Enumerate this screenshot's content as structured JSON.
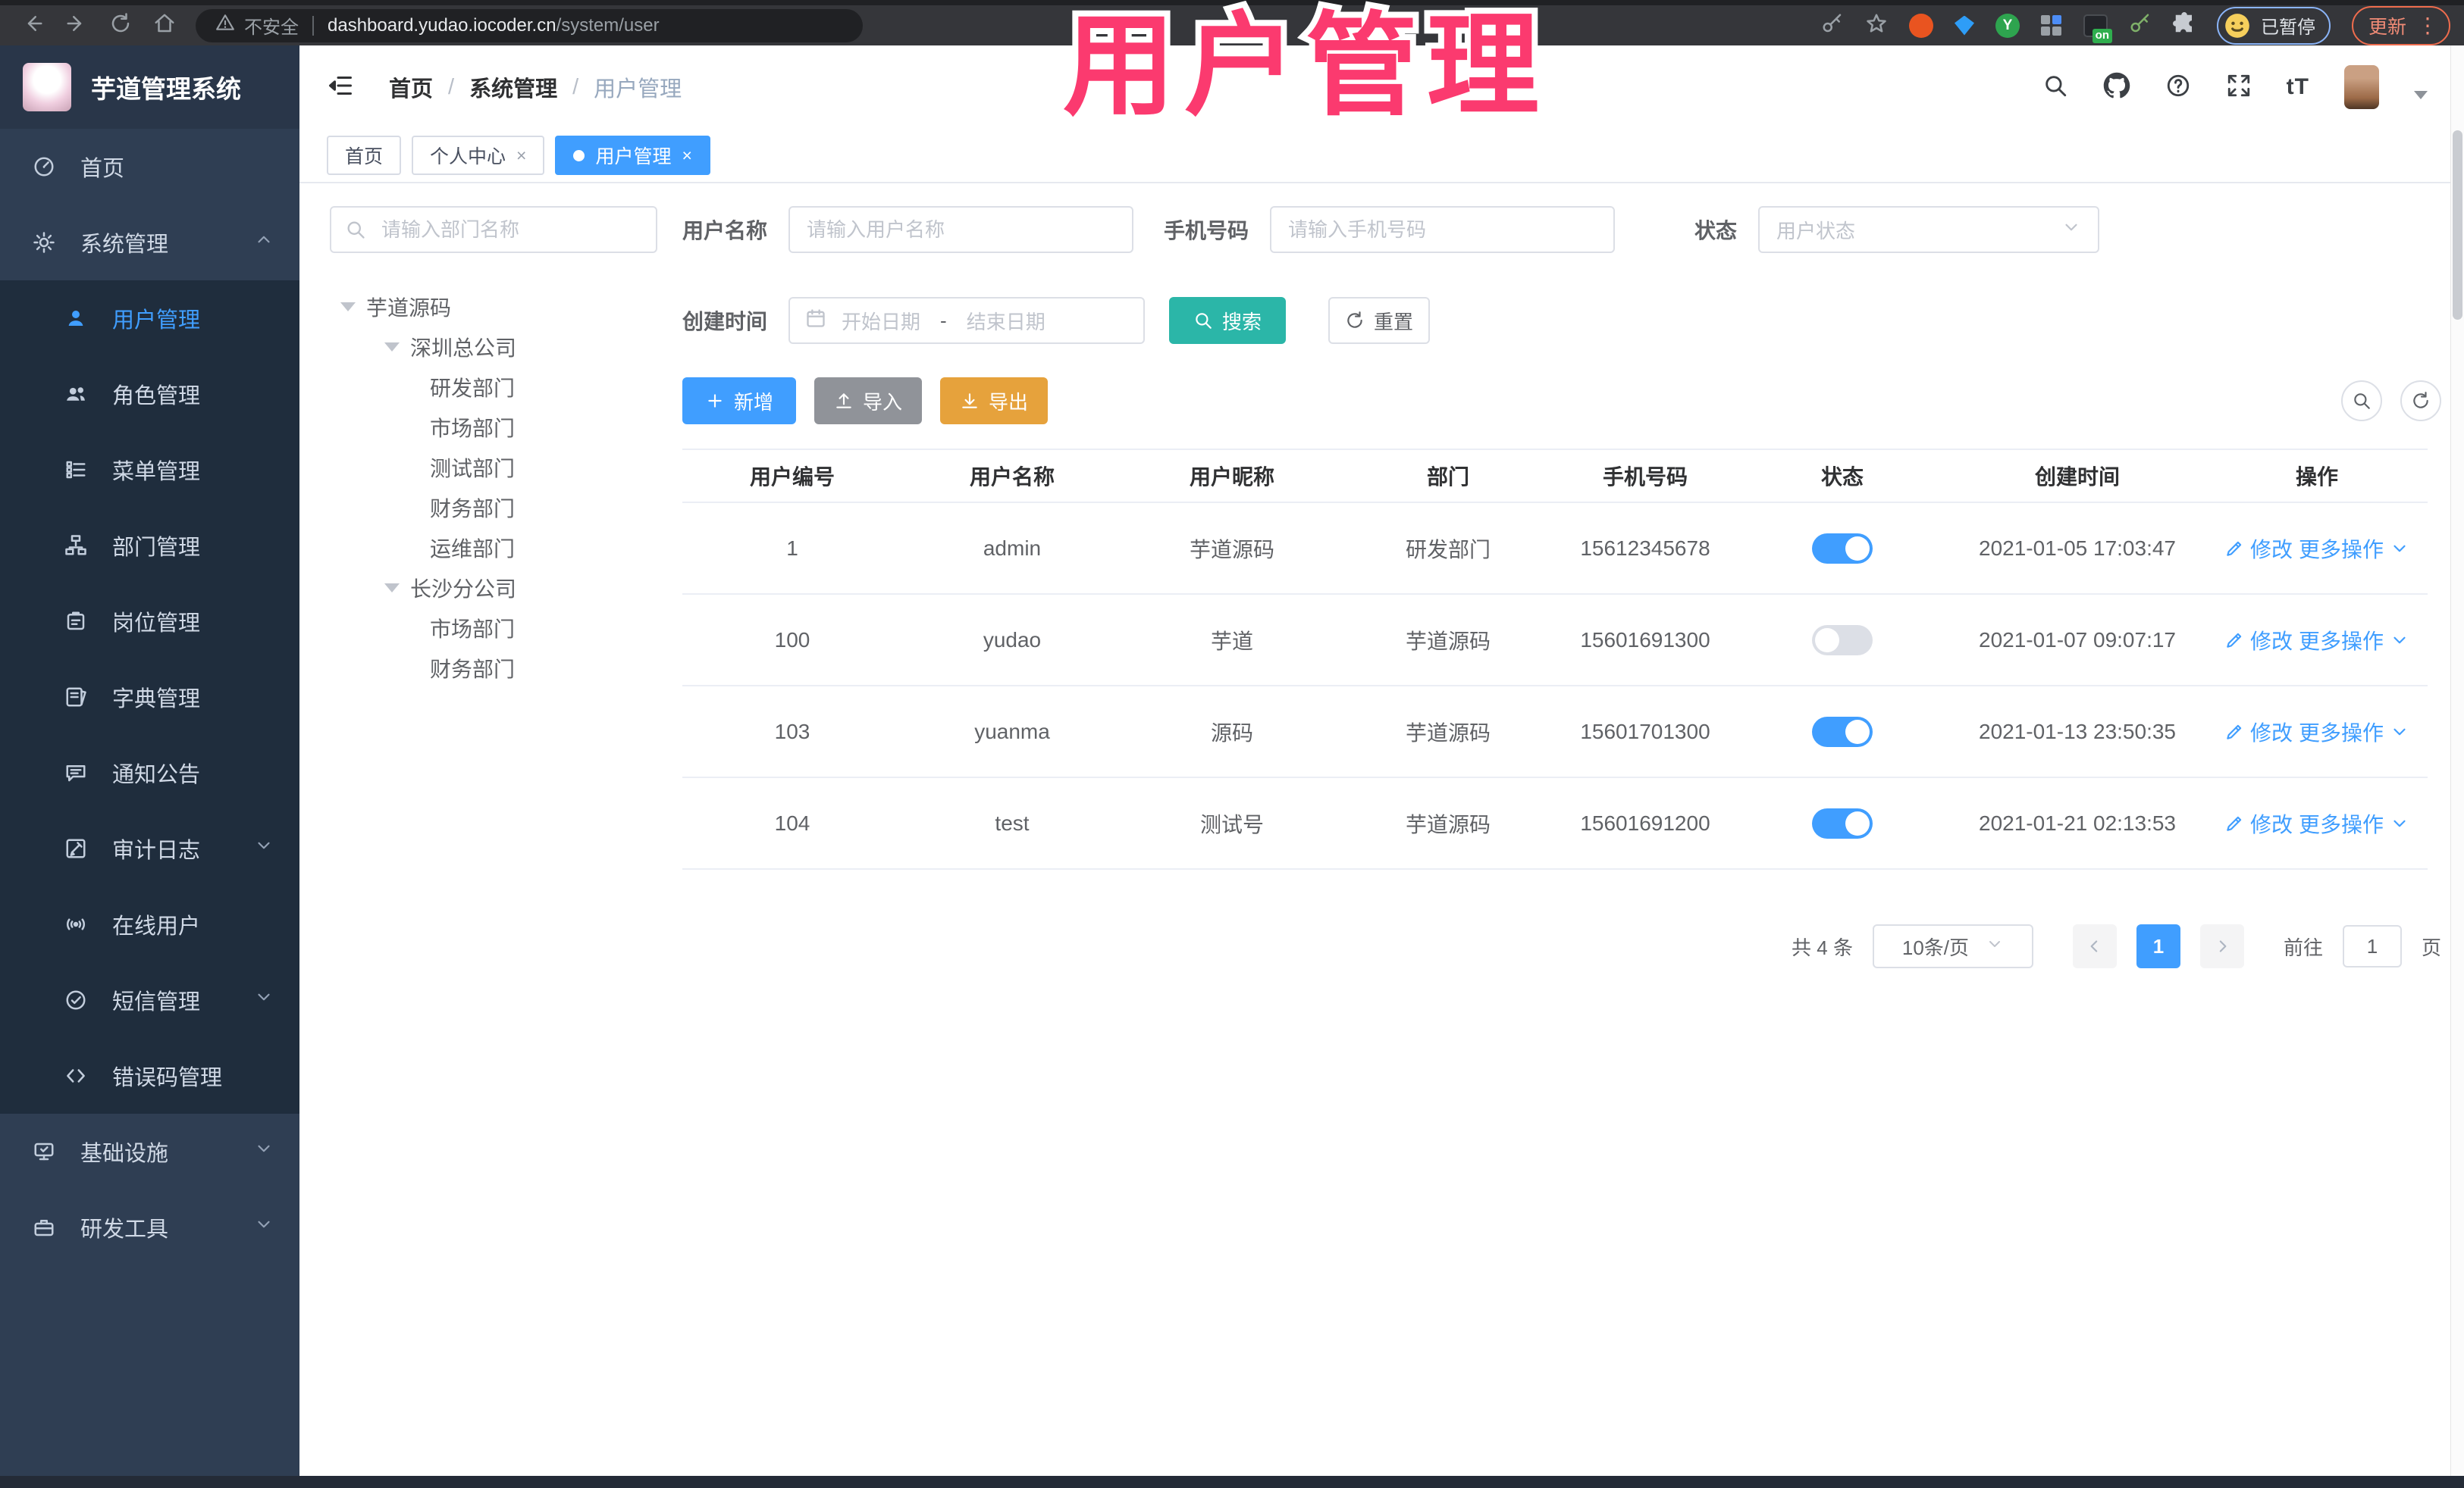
{
  "browser": {
    "security_label": "不安全",
    "url_host": "dashboard.yudao.iocoder.cn",
    "url_path": "/system/user",
    "paused_badge": "已暂停",
    "update_label": "更新"
  },
  "ui": {
    "close_glyph": "×",
    "slash": "/",
    "kebab": "⋮",
    "font_size_button": "tT",
    "on_badge": "on",
    "y_badge": "Y"
  },
  "overlay": {
    "title": "用户管理",
    "color": "#FB3A6F"
  },
  "app_header": {
    "title": "芋道管理系统",
    "breadcrumb": [
      "首页",
      "系统管理",
      "用户管理"
    ]
  },
  "tabs": [
    {
      "label": "首页"
    },
    {
      "label": "个人中心"
    },
    {
      "label": "用户管理"
    }
  ],
  "sidebar": {
    "items": [
      {
        "label": "首页",
        "icon": "dashboard"
      },
      {
        "label": "系统管理",
        "icon": "gear",
        "state": "expanded"
      },
      {
        "label": "用户管理",
        "icon": "user",
        "active": true
      },
      {
        "label": "角色管理",
        "icon": "users"
      },
      {
        "label": "菜单管理",
        "icon": "menu-list"
      },
      {
        "label": "部门管理",
        "icon": "org-tree"
      },
      {
        "label": "岗位管理",
        "icon": "badge"
      },
      {
        "label": "字典管理",
        "icon": "dictionary"
      },
      {
        "label": "通知公告",
        "icon": "announcement"
      },
      {
        "label": "审计日志",
        "icon": "audit-log",
        "state": "collapsed"
      },
      {
        "label": "在线用户",
        "icon": "online-users"
      },
      {
        "label": "短信管理",
        "icon": "sms",
        "state": "collapsed"
      },
      {
        "label": "错误码管理",
        "icon": "error-code"
      },
      {
        "label": "基础设施",
        "icon": "infrastructure",
        "state": "collapsed"
      },
      {
        "label": "研发工具",
        "icon": "dev-tools",
        "state": "collapsed"
      }
    ]
  },
  "dept_panel": {
    "search_placeholder": "请输入部门名称",
    "tree": [
      {
        "label": "芋道源码",
        "level": 0,
        "expanded": true
      },
      {
        "label": "深圳总公司",
        "level": 1,
        "expanded": true
      },
      {
        "label": "研发部门",
        "level": 2
      },
      {
        "label": "市场部门",
        "level": 2
      },
      {
        "label": "测试部门",
        "level": 2
      },
      {
        "label": "财务部门",
        "level": 2
      },
      {
        "label": "运维部门",
        "level": 2
      },
      {
        "label": "长沙分公司",
        "level": 1,
        "expanded": true
      },
      {
        "label": "市场部门",
        "level": 2
      },
      {
        "label": "财务部门",
        "level": 2
      }
    ]
  },
  "filters": {
    "user_name_label": "用户名称",
    "user_name_placeholder": "请输入用户名称",
    "mobile_label": "手机号码",
    "mobile_placeholder": "请输入手机号码",
    "status_label": "状态",
    "status_placeholder": "用户状态",
    "create_time_label": "创建时间",
    "date_start_placeholder": "开始日期",
    "date_separator": "-",
    "date_end_placeholder": "结束日期",
    "search_button": "搜索",
    "reset_button": "重置"
  },
  "toolbar": {
    "add_label": "新增",
    "import_label": "导入",
    "export_label": "导出"
  },
  "table": {
    "headers": [
      "用户编号",
      "用户名称",
      "用户昵称",
      "部门",
      "手机号码",
      "状态",
      "创建时间",
      "操作"
    ],
    "actions": {
      "edit": "修改",
      "more": "更多操作"
    },
    "rows": [
      {
        "id": "1",
        "username": "admin",
        "nickname": "芋道源码",
        "dept": "研发部门",
        "mobile": "15612345678",
        "status_on": true,
        "created": "2021-01-05 17:03:47"
      },
      {
        "id": "100",
        "username": "yudao",
        "nickname": "芋道",
        "dept": "芋道源码",
        "mobile": "15601691300",
        "status_on": false,
        "created": "2021-01-07 09:07:17"
      },
      {
        "id": "103",
        "username": "yuanma",
        "nickname": "源码",
        "dept": "芋道源码",
        "mobile": "15601701300",
        "status_on": true,
        "created": "2021-01-13 23:50:35"
      },
      {
        "id": "104",
        "username": "test",
        "nickname": "测试号",
        "dept": "芋道源码",
        "mobile": "15601691200",
        "status_on": true,
        "created": "2021-01-21 02:13:53"
      }
    ]
  },
  "pagination": {
    "total": "共 4 条",
    "page_size": "10条/页",
    "page": "1",
    "goto_label": "前往",
    "goto_value": "1",
    "page_unit": "页"
  },
  "colors": {
    "accent": "#409EFF",
    "search_teal": "#2BB6A8",
    "export_orange": "#E6A23C",
    "import_gray": "#909399",
    "overlay_pink": "#FB3A6F",
    "sidebar_bg": "#2f3e53",
    "submenu_bg": "#1f2d3d"
  }
}
